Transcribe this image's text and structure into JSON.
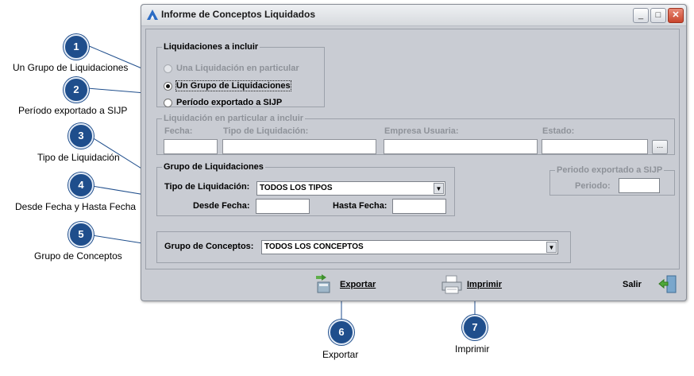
{
  "window": {
    "title": "Informe de Conceptos Liquidados",
    "controls": {
      "minimize": "_",
      "maximize": "□",
      "close": "✕"
    }
  },
  "liquidaciones_incluir": {
    "legend": "Liquidaciones a incluir",
    "options": [
      {
        "label": "Una Liquidación en particular",
        "selected": false,
        "enabled": false
      },
      {
        "label": "Un Grupo de Liquidaciones",
        "selected": true,
        "enabled": true
      },
      {
        "label": "Período exportado a SIJP",
        "selected": false,
        "enabled": true
      }
    ]
  },
  "liquidacion_particular": {
    "legend": "Liquidación en particular a incluir",
    "fecha_label": "Fecha:",
    "tipo_label": "Tipo de Liquidación:",
    "empresa_label": "Empresa Usuaria:",
    "estado_label": "Estado:",
    "browse_label": "..."
  },
  "grupo_liquidaciones": {
    "legend": "Grupo de Liquidaciones",
    "tipo_label": "Tipo de Liquidación:",
    "tipo_value": "TODOS LOS TIPOS",
    "desde_label": "Desde Fecha:",
    "hasta_label": "Hasta Fecha:"
  },
  "periodo_sijp": {
    "legend": "Periodo exportado a SIJP",
    "periodo_label": "Periodo:"
  },
  "grupo_conceptos": {
    "label": "Grupo de Conceptos:",
    "value": "TODOS LOS CONCEPTOS"
  },
  "actions": {
    "exportar": "Exportar",
    "imprimir": "Imprimir",
    "salir": "Salir"
  },
  "callouts": [
    {
      "number": "1",
      "text": "Un Grupo de Liquidaciones"
    },
    {
      "number": "2",
      "text": "Período exportado a SIJP"
    },
    {
      "number": "3",
      "text": "Tipo de Liquidación"
    },
    {
      "number": "4",
      "text": "Desde Fecha y Hasta Fecha"
    },
    {
      "number": "5",
      "text": "Grupo de Conceptos"
    },
    {
      "number": "6",
      "text": "Exportar"
    },
    {
      "number": "7",
      "text": "Imprimir"
    }
  ],
  "colors": {
    "window_bg": "#c9ccd3",
    "callout_blue": "#1f4e8c",
    "disabled_text": "#8e9299"
  }
}
